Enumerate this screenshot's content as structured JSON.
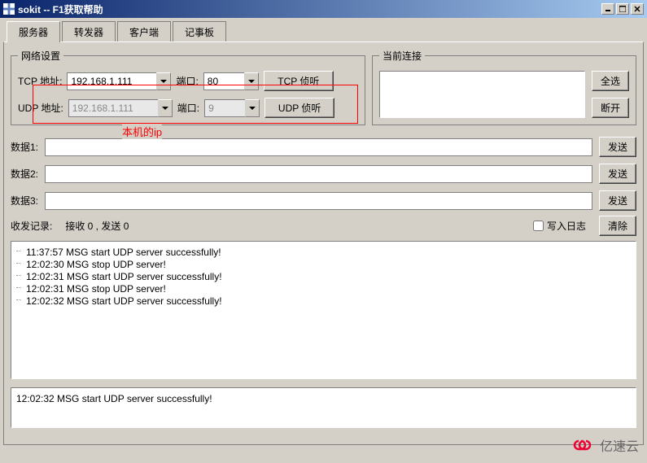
{
  "title": "sokit -- F1获取帮助",
  "tabs": [
    {
      "id": "server",
      "label": "服务器",
      "active": true
    },
    {
      "id": "forwarder",
      "label": "转发器",
      "active": false
    },
    {
      "id": "client",
      "label": "客户端",
      "active": false
    },
    {
      "id": "notepad",
      "label": "记事板",
      "active": false
    }
  ],
  "net_settings": {
    "legend": "网络设置",
    "tcp": {
      "addr_label": "TCP 地址:",
      "addr": "192.168.1.111",
      "port_label": "端口:",
      "port": "80",
      "btn": "TCP 侦听"
    },
    "udp": {
      "addr_label": "UDP 地址:",
      "addr": "192.168.1.111",
      "port_label": "端口:",
      "port": "9",
      "btn": "UDP 侦听"
    }
  },
  "current_conn": {
    "legend": "当前连接",
    "select_all": "全选",
    "disconnect": "断开"
  },
  "data": {
    "rows": [
      {
        "label": "数据1:",
        "value": "",
        "send": "发送"
      },
      {
        "label": "数据2:",
        "value": "",
        "send": "发送"
      },
      {
        "label": "数据3:",
        "value": "",
        "send": "发送"
      }
    ]
  },
  "log_header": {
    "title": "收发记录:",
    "stats": "接收 0 , 发送 0",
    "write_log": "写入日志",
    "clear": "清除"
  },
  "log_lines": [
    "11:37:57 MSG start UDP server successfully!",
    "12:02:30 MSG stop UDP server!",
    "12:02:31 MSG start UDP server successfully!",
    "12:02:31 MSG stop UDP server!",
    "12:02:32 MSG start UDP server successfully!"
  ],
  "status_text": "12:02:32 MSG start UDP server successfully!",
  "annotation": "本机的ip",
  "watermark": "亿速云"
}
